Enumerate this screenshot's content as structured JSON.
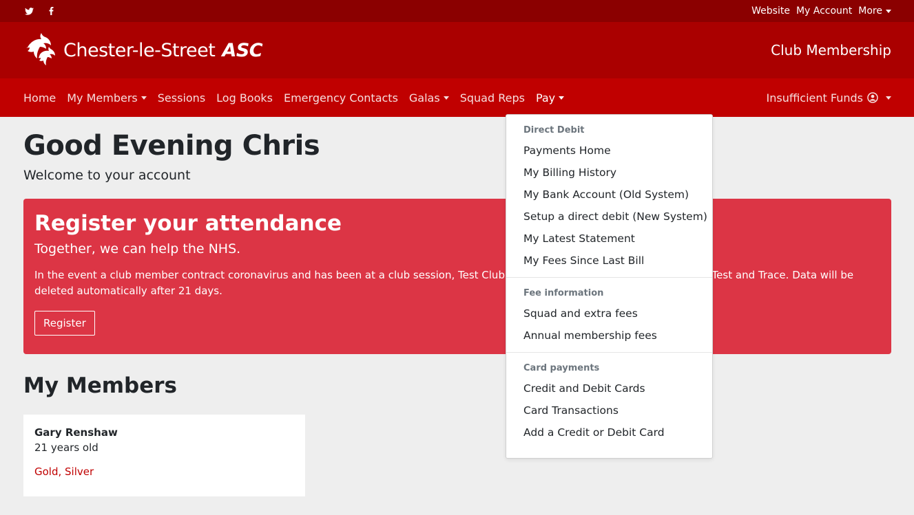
{
  "topbar": {
    "social": [
      {
        "icon": "twitter-icon"
      },
      {
        "icon": "facebook-icon"
      }
    ],
    "links": {
      "website": "Website",
      "my_account": "My Account",
      "more": "More"
    }
  },
  "brand": {
    "name": "Chester-le-Street",
    "suffix": "ASC",
    "logo_icon": "dolphins-logo-icon",
    "section_title": "Club Membership"
  },
  "nav": {
    "items": [
      {
        "label": "Home"
      },
      {
        "label": "My Members"
      },
      {
        "label": "Sessions"
      },
      {
        "label": "Log Books"
      },
      {
        "label": "Emergency Contacts"
      },
      {
        "label": "Galas"
      },
      {
        "label": "Squad Reps"
      },
      {
        "label": "Pay"
      }
    ],
    "account_label": "Insufficient Funds"
  },
  "main": {
    "greeting": "Good Evening Chris",
    "welcome": "Welcome to your account",
    "alert": {
      "title": "Register your attendance",
      "subtitle": "Together, we can help the NHS.",
      "text_part1": "In the event a club member contract coronavirus and has been at a club session, Test Club w",
      "text_part2": "HS Test and Trace. Data will be deleted automatically after 21 days.",
      "button": "Register"
    },
    "members_heading": "My Members",
    "members": [
      {
        "name": "Gary Renshaw",
        "age": "21 years old",
        "squads": "Gold, Silver"
      }
    ]
  },
  "pay_menu": {
    "sections": [
      {
        "header": "Direct Debit",
        "items": [
          "Payments Home",
          "My Billing History",
          "My Bank Account (Old System)",
          "Setup a direct debit (New System)",
          "My Latest Statement",
          "My Fees Since Last Bill"
        ]
      },
      {
        "header": "Fee information",
        "items": [
          "Squad and extra fees",
          "Annual membership fees"
        ]
      },
      {
        "header": "Card payments",
        "items": [
          "Credit and Debit Cards",
          "Card Transactions",
          "Add a Credit or Debit Card"
        ]
      }
    ]
  },
  "colors": {
    "topbar": "#8b0000",
    "brandbar": "#aa0000",
    "nav": "#c00000",
    "alert": "#dc3545",
    "page_bg": "#eeeeee"
  }
}
